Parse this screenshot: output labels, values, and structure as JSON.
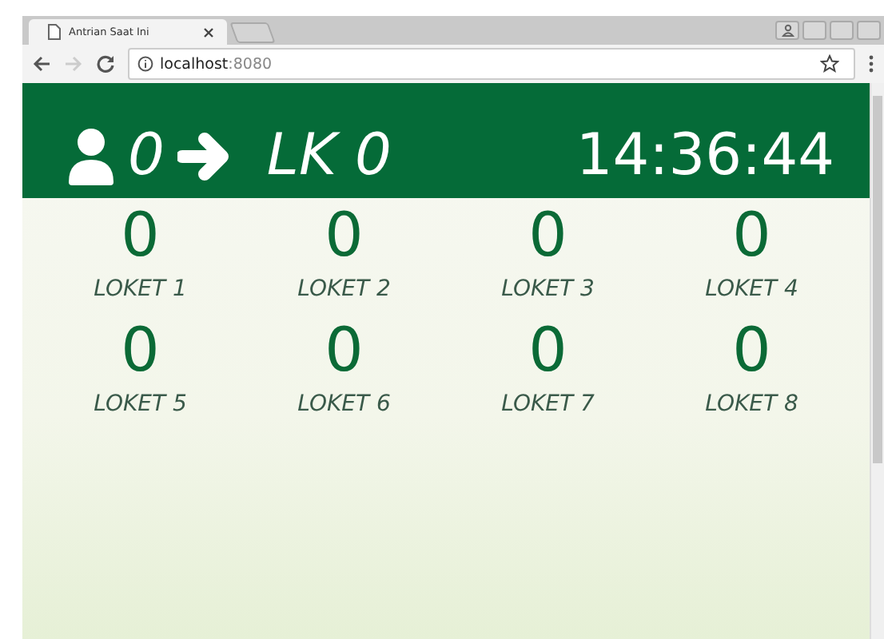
{
  "browser": {
    "tabs": [
      {
        "title": "Antrian Saat Ini",
        "selected": true
      }
    ],
    "address": {
      "host": "localhost",
      "port": ":8080"
    }
  },
  "header": {
    "queue_number": "0",
    "counter": "LK 0",
    "time": "14:36:44"
  },
  "counters": [
    {
      "number": "0",
      "label": "LOKET 1"
    },
    {
      "number": "0",
      "label": "LOKET 2"
    },
    {
      "number": "0",
      "label": "LOKET 3"
    },
    {
      "number": "0",
      "label": "LOKET 4"
    },
    {
      "number": "0",
      "label": "LOKET 5"
    },
    {
      "number": "0",
      "label": "LOKET 6"
    },
    {
      "number": "0",
      "label": "LOKET 7"
    },
    {
      "number": "0",
      "label": "LOKET 8"
    }
  ]
}
